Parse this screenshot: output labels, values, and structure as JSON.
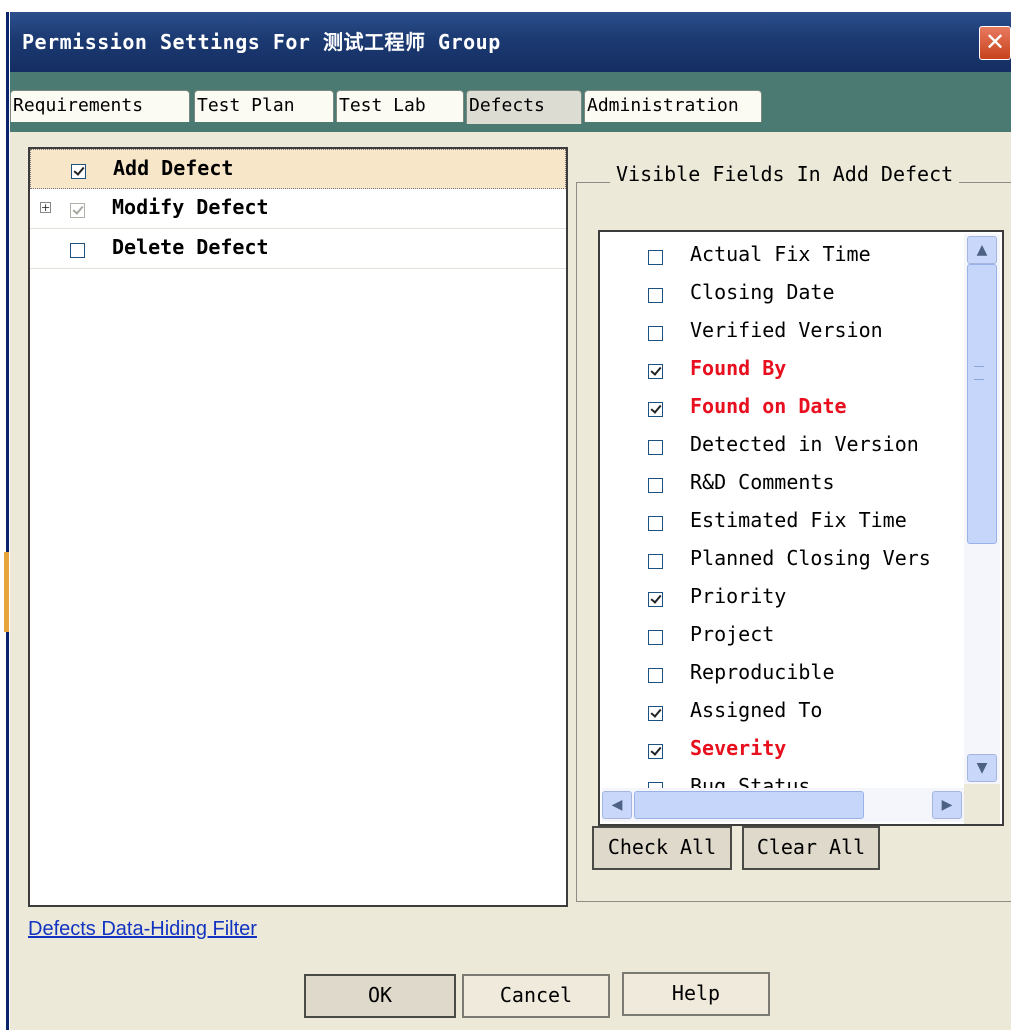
{
  "window": {
    "title": "Permission Settings For 测试工程师 Group",
    "close_glyph": "✕"
  },
  "tabs": [
    {
      "label": "Requirements"
    },
    {
      "label": "Test Plan"
    },
    {
      "label": "Test Lab"
    },
    {
      "label": "Defects",
      "active": true
    },
    {
      "label": "Administration"
    }
  ],
  "permissions": [
    {
      "label": "Add Defect",
      "checked": true,
      "selected": true,
      "expandable": false
    },
    {
      "label": "Modify Defect",
      "checked": true,
      "disabled": true,
      "expandable": true,
      "expander_glyph": "+"
    },
    {
      "label": "Delete Defect",
      "checked": false,
      "expandable": false
    }
  ],
  "visible_fields": {
    "title": "Visible Fields In Add Defect",
    "items": [
      {
        "label": "Actual Fix Time",
        "checked": false,
        "required": false
      },
      {
        "label": "Closing Date",
        "checked": false,
        "required": false
      },
      {
        "label": "Verified Version",
        "checked": false,
        "required": false
      },
      {
        "label": "Found By",
        "checked": true,
        "required": true
      },
      {
        "label": "Found on Date",
        "checked": true,
        "required": true
      },
      {
        "label": "Detected in Version",
        "checked": false,
        "required": false
      },
      {
        "label": "R&D Comments",
        "checked": false,
        "required": false
      },
      {
        "label": "Estimated Fix Time",
        "checked": false,
        "required": false
      },
      {
        "label": "Planned Closing Vers",
        "checked": false,
        "required": false
      },
      {
        "label": "Priority",
        "checked": true,
        "required": false
      },
      {
        "label": "Project",
        "checked": false,
        "required": false
      },
      {
        "label": "Reproducible",
        "checked": false,
        "required": false
      },
      {
        "label": "Assigned To",
        "checked": true,
        "required": false
      },
      {
        "label": "Severity",
        "checked": true,
        "required": true
      },
      {
        "label": "Bug Status",
        "checked": false,
        "required": false
      }
    ],
    "scroll_icons": {
      "up": "▲",
      "down": "▼",
      "left": "◀",
      "right": "▶"
    }
  },
  "buttons": {
    "check_all": "Check All",
    "clear_all": "Clear All",
    "ok": "OK",
    "cancel": "Cancel",
    "help": "Help"
  },
  "link": {
    "label": "Defects Data-Hiding Filter"
  },
  "colors": {
    "title_bar": "#1c3a72",
    "tab_strip": "#4a7a72",
    "required_field": "#e8101e",
    "link": "#1233c2",
    "dialog_bg": "#ece9d8"
  }
}
